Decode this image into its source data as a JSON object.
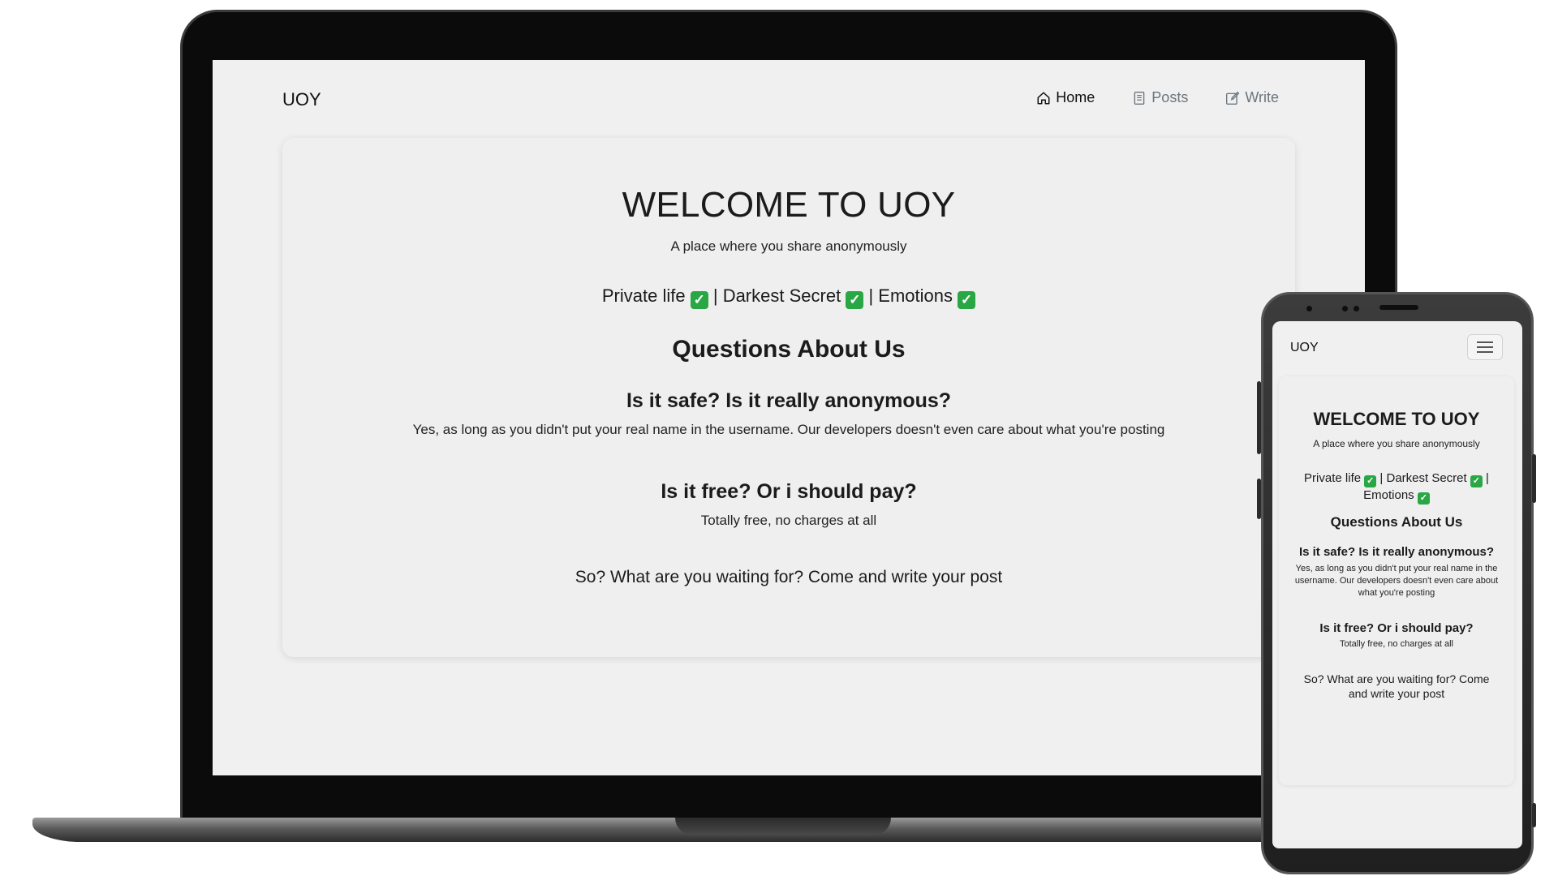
{
  "laptop": {
    "nav": {
      "brand": "UOY",
      "links": [
        {
          "label": "Home",
          "icon": "home-icon",
          "active": true
        },
        {
          "label": "Posts",
          "icon": "posts-icon",
          "active": false
        },
        {
          "label": "Write",
          "icon": "edit-icon",
          "active": false
        }
      ]
    },
    "hero": {
      "title": "WELCOME TO UOY",
      "subtitle": "A place where you share anonymously",
      "tags": [
        "Private life",
        "Darkest Secret",
        "Emotions"
      ],
      "tag_separator": "|"
    },
    "faq": {
      "heading": "Questions About Us",
      "items": [
        {
          "question": "Is it safe? Is it really anonymous?",
          "answer": "Yes, as long as you didn't put your real name in the username. Our developers doesn't even care about what you're posting"
        },
        {
          "question": "Is it free? Or i should pay?",
          "answer": "Totally free, no charges at all"
        }
      ],
      "cta": "So? What are you waiting for? Come and write your post"
    }
  },
  "phone": {
    "nav": {
      "brand": "UOY",
      "menu_icon": "hamburger-icon"
    },
    "hero": {
      "title": "WELCOME TO UOY",
      "subtitle": "A place where you share anonymously",
      "tags": [
        "Private life",
        "Darkest Secret",
        "Emotions"
      ]
    },
    "faq": {
      "heading": "Questions About Us",
      "items": [
        {
          "question": "Is it safe? Is it really anonymous?",
          "answer": "Yes, as long as you didn't put your real name in the username. Our developers doesn't even care about what you're posting"
        },
        {
          "question": "Is it free? Or i should pay?",
          "answer": "Totally free, no charges at all"
        }
      ],
      "cta": "So? What are you waiting for? Come and write your post"
    }
  },
  "colors": {
    "page_bg": "#f0f0f0",
    "check_green": "#29a745",
    "text_dark": "#1b1b1b",
    "nav_muted": "#6c757d"
  }
}
